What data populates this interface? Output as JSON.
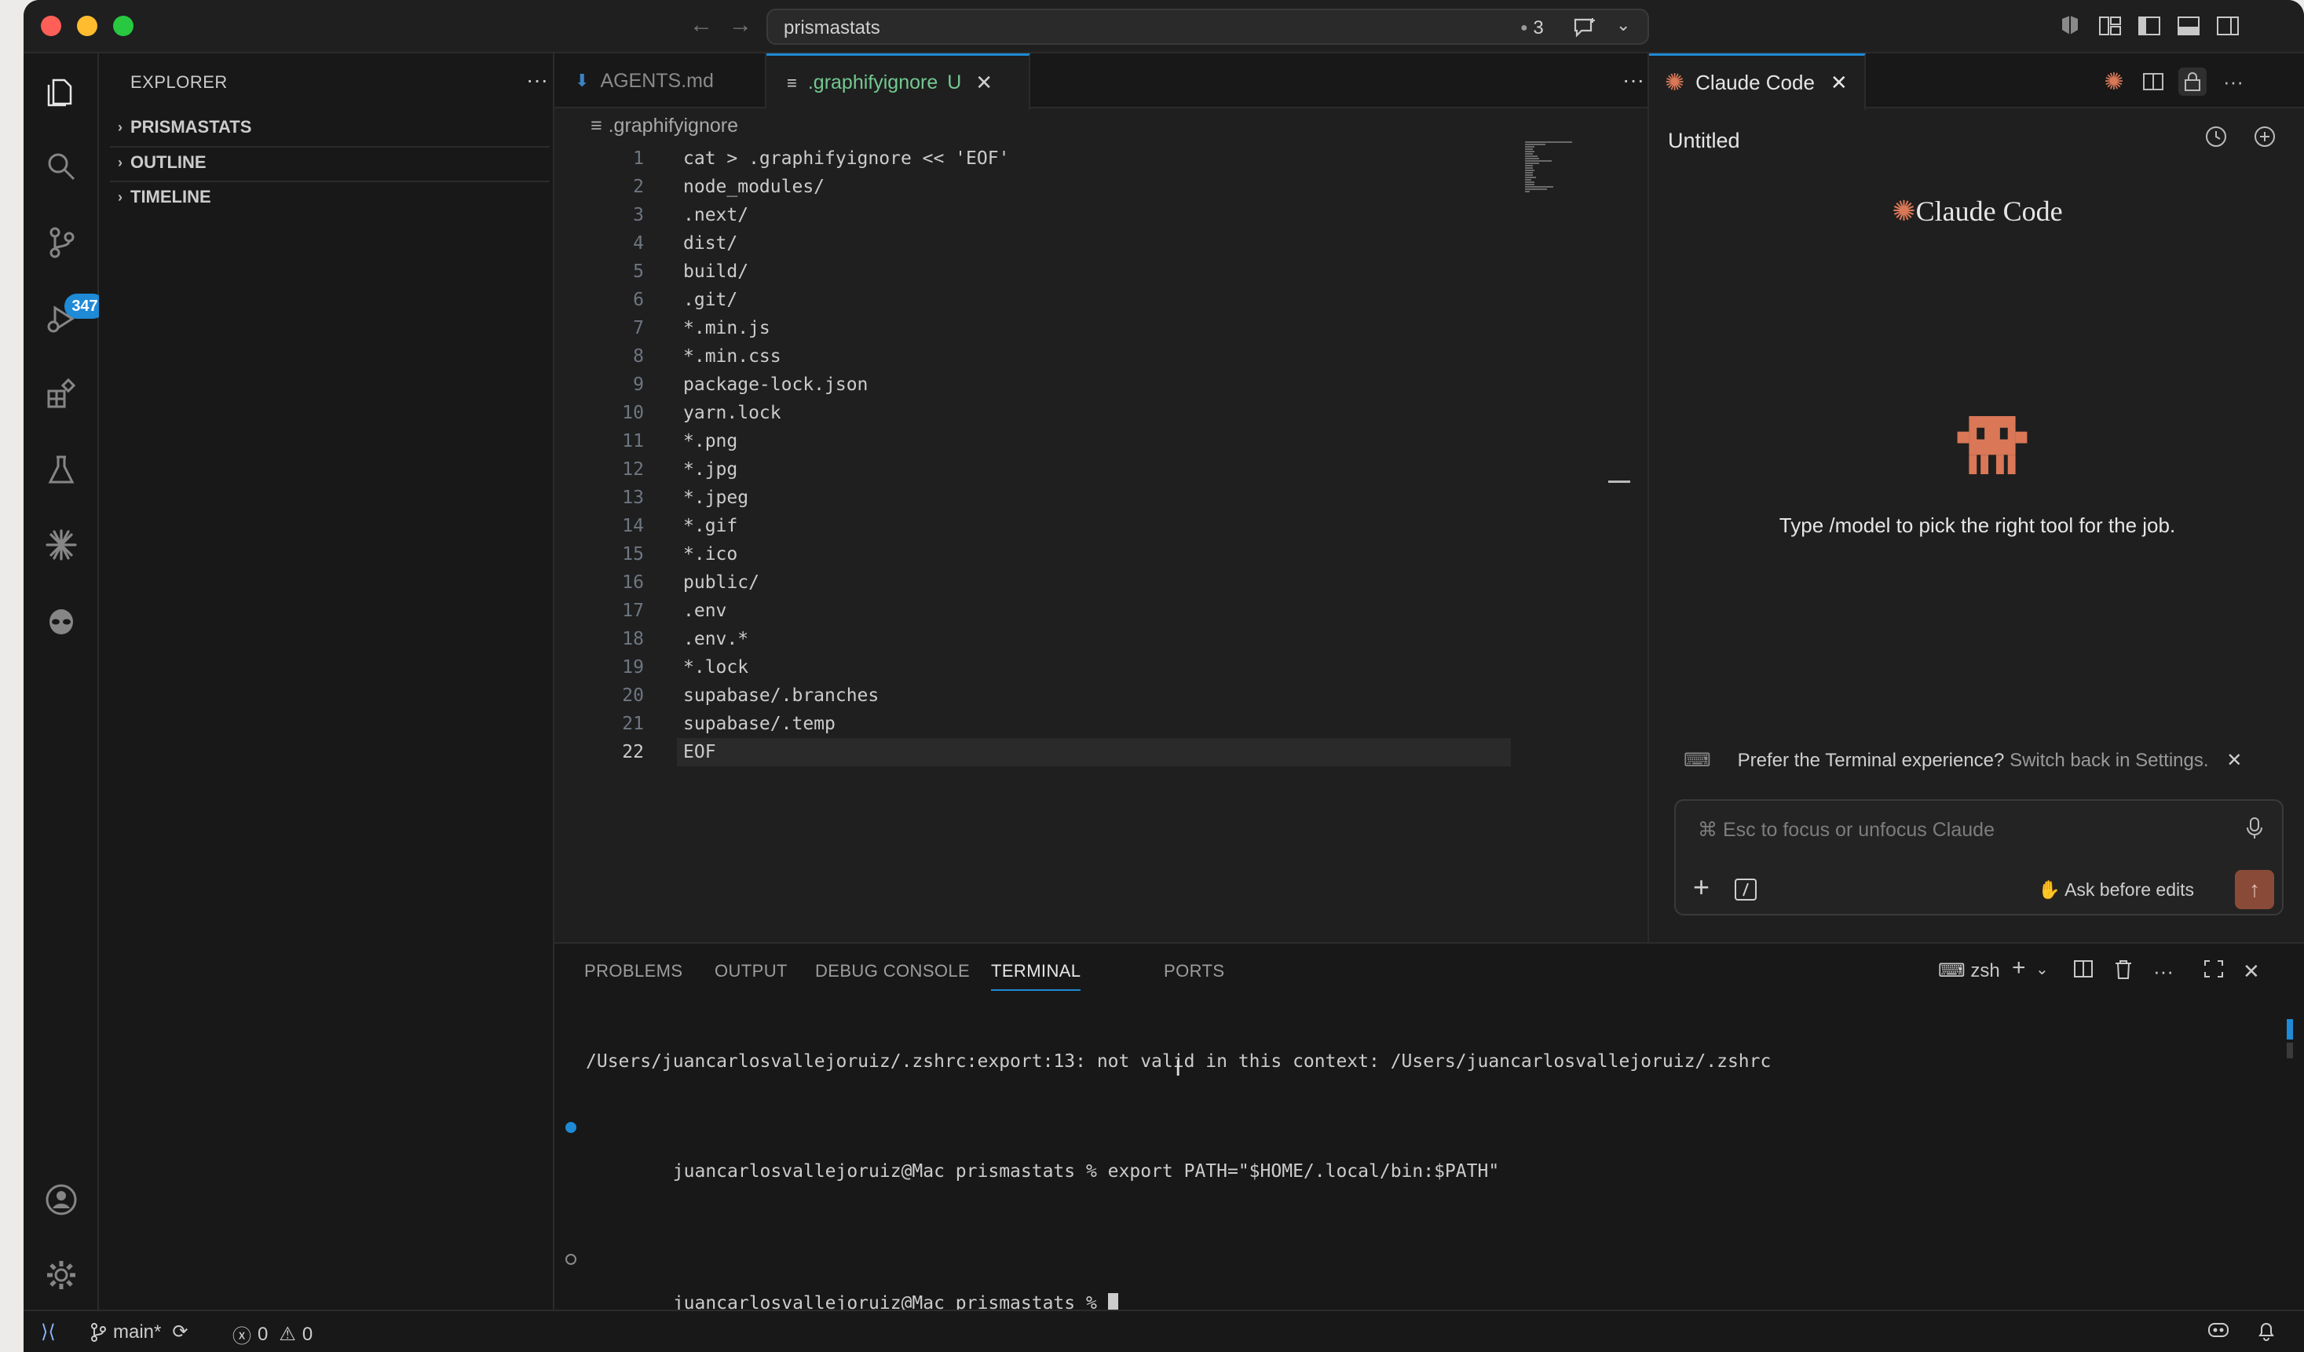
{
  "window": {
    "search_text": "prismastats",
    "notif_count": "3"
  },
  "colors": {
    "accent": "#1f8ad6",
    "claude_orange": "#d97757",
    "git_untracked": "#73c991"
  },
  "activity_bar": {
    "source_control_badge": "347"
  },
  "sidebar": {
    "title": "EXPLORER",
    "sections": [
      "PRISMASTATS",
      "OUTLINE",
      "TIMELINE"
    ]
  },
  "editor": {
    "tabs": [
      {
        "label": "AGENTS.md"
      },
      {
        "label": ".graphifyignore",
        "badge": "U"
      }
    ],
    "breadcrumb": ".graphifyignore",
    "current_line": 22,
    "lines": [
      "cat > .graphifyignore << 'EOF'",
      "node_modules/",
      ".next/",
      "dist/",
      "build/",
      ".git/",
      "*.min.js",
      "*.min.css",
      "package-lock.json",
      "yarn.lock",
      "*.png",
      "*.jpg",
      "*.jpeg",
      "*.gif",
      "*.ico",
      "public/",
      ".env",
      ".env.*",
      "*.lock",
      "supabase/.branches",
      "supabase/.temp",
      "EOF"
    ]
  },
  "claude": {
    "tab_label": "Claude Code",
    "session_title": "Untitled",
    "brand": "Claude Code",
    "hint": "Type /model to pick the right tool for the job.",
    "prefer_text": "Prefer the Terminal experience?",
    "prefer_link": "Switch back in Settings.",
    "input_placeholder": "⌘ Esc to focus or unfocus Claude",
    "mode_label": "Ask before edits"
  },
  "panel": {
    "tabs": [
      "PROBLEMS",
      "OUTPUT",
      "DEBUG CONSOLE",
      "TERMINAL",
      "PORTS"
    ],
    "active_tab": "TERMINAL",
    "shell": "zsh",
    "terminal_lines": [
      "/Users/juancarlosvallejoruiz/.zshrc:export:13: not valid in this context: /Users/juancarlosvallejoruiz/.zshrc",
      "juancarlosvallejoruiz@Mac prismastats % export PATH=\"$HOME/.local/bin:$PATH\"",
      "juancarlosvallejoruiz@Mac prismastats % "
    ]
  },
  "statusbar": {
    "branch": "main*",
    "errors": "0",
    "warnings": "0"
  }
}
